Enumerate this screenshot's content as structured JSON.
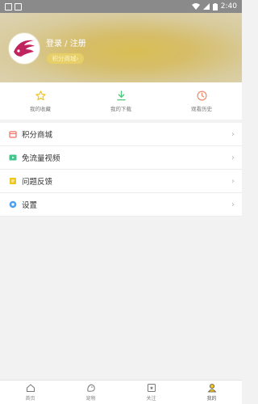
{
  "status_bar": {
    "time": "2:40"
  },
  "header": {
    "login_label": "登录 / 注册",
    "points_label": "积分商城"
  },
  "quick_actions": [
    {
      "label": "我的收藏",
      "icon": "star-icon",
      "color": "#f0c419"
    },
    {
      "label": "我的下载",
      "icon": "download-icon",
      "color": "#4cc87a"
    },
    {
      "label": "观看历史",
      "icon": "history-icon",
      "color": "#f08a6a"
    }
  ],
  "menu": [
    {
      "label": "积分商城",
      "icon": "shop-icon",
      "color": "#f26b5b"
    },
    {
      "label": "免流量视频",
      "icon": "video-icon",
      "color": "#3fc48a"
    },
    {
      "label": "问题反馈",
      "icon": "feedback-icon",
      "color": "#f0c419"
    },
    {
      "label": "设置",
      "icon": "settings-icon",
      "color": "#4a9ff0"
    }
  ],
  "tabs": [
    {
      "label": "首页",
      "icon": "home-icon"
    },
    {
      "label": "宠物",
      "icon": "pet-icon"
    },
    {
      "label": "关注",
      "icon": "follow-icon"
    },
    {
      "label": "我的",
      "icon": "profile-icon",
      "active": true
    }
  ],
  "colors": {
    "accent": "#f0c419",
    "header": "#d9be55"
  }
}
